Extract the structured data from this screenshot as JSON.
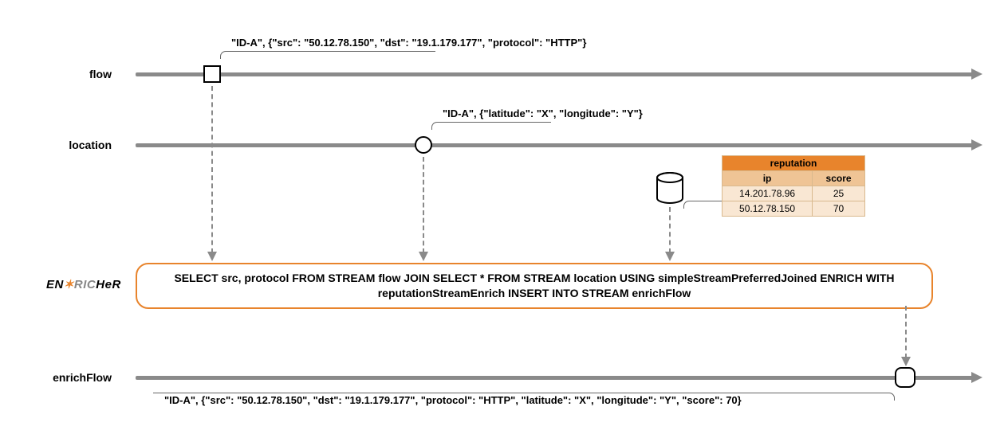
{
  "streams": {
    "flow": {
      "label": "flow",
      "event_label": "\"ID-A\", {\"src\": \"50.12.78.150\", \"dst\": \"19.1.179.177\", \"protocol\": \"HTTP\"}"
    },
    "location": {
      "label": "location",
      "event_label": "\"ID-A\", {\"latitude\": \"X\", \"longitude\": \"Y\"}"
    },
    "enrichFlow": {
      "label": "enrichFlow",
      "event_label": "\"ID-A\", {\"src\": \"50.12.78.150\", \"dst\": \"19.1.179.177\", \"protocol\": \"HTTP\", \"latitude\": \"X\", \"longitude\": \"Y\", \"score\": 70}"
    }
  },
  "reputation_table": {
    "title": "reputation",
    "headers": {
      "col1": "ip",
      "col2": "score"
    },
    "rows": [
      {
        "ip": "14.201.78.96",
        "score": "25"
      },
      {
        "ip": "50.12.78.150",
        "score": "70"
      }
    ]
  },
  "query": {
    "text": "SELECT src, protocol FROM STREAM flow JOIN SELECT * FROM STREAM location USING simpleStreamPreferredJoined ENRICH WITH reputationStreamEnrich INSERT INTO STREAM enrichFlow"
  },
  "logo": {
    "en": "EN",
    "ric": "RIC",
    "her": "HeR"
  }
}
